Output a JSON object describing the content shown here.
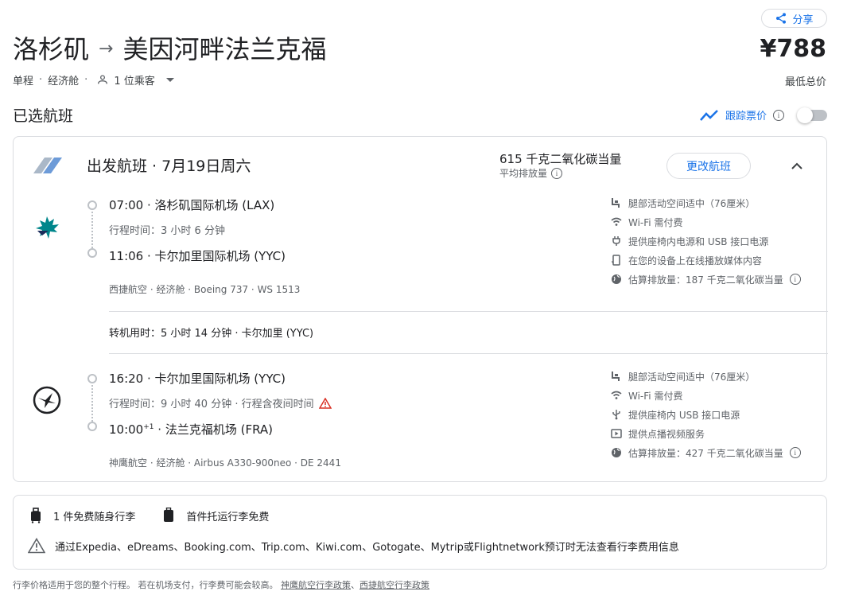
{
  "header": {
    "share_label": "分享",
    "origin": "洛杉矶",
    "destination": "美因河畔法兰克福",
    "trip_type": "单程",
    "cabin": "经济舱",
    "passengers": "1 位乘客",
    "price": "¥788",
    "price_label": "最低总价"
  },
  "selected": {
    "title": "已选航班",
    "track_label": "跟踪票价"
  },
  "flight": {
    "title": "出发航班 · 7月19日周六",
    "co2_main": "615 千克二氧化碳当量",
    "co2_sub": "平均排放量",
    "change_label": "更改航班",
    "layover": "转机用时：5 小时 14 分钟 · 卡尔加里 (YYC)",
    "segments": [
      {
        "dep": "07:00 · 洛杉矶国际机场 (LAX)",
        "duration": "行程时间：3 小时 6 分钟",
        "arr_time": "11:06",
        "arr_sup": "",
        "arr_airport": " · 卡尔加里国际机场 (YYC)",
        "detail": "西捷航空 · 经济舱 · Boeing 737 · WS 1513",
        "amenities": [
          {
            "icon": "legroom-icon",
            "text": "腿部活动空间适中（76厘米）"
          },
          {
            "icon": "wifi-icon",
            "text": "Wi-Fi 需付费"
          },
          {
            "icon": "power-plug-icon",
            "text": "提供座椅内电源和 USB 接口电源"
          },
          {
            "icon": "device-stream-icon",
            "text": "在您的设备上在线播放媒体内容"
          },
          {
            "icon": "globe-icon",
            "text": "估算排放量：187 千克二氧化碳当量"
          }
        ]
      },
      {
        "dep": "16:20 · 卡尔加里国际机场 (YYC)",
        "duration": "行程时间：9 小时 40 分钟 · 行程含夜间时间",
        "arr_time": "10:00",
        "arr_sup": "+1",
        "arr_airport": " · 法兰克福机场 (FRA)",
        "detail": "神鹰航空 · 经济舱 · Airbus A330-900neo · DE 2441",
        "amenities": [
          {
            "icon": "legroom-icon",
            "text": "腿部活动空间适中（76厘米）"
          },
          {
            "icon": "wifi-icon",
            "text": "Wi-Fi 需付费"
          },
          {
            "icon": "usb-icon",
            "text": "提供座椅内 USB 接口电源"
          },
          {
            "icon": "video-icon",
            "text": "提供点播视频服务"
          },
          {
            "icon": "globe-icon",
            "text": "估算排放量：427 千克二氧化碳当量"
          }
        ]
      }
    ]
  },
  "baggage": {
    "carry_on": "1 件免费随身行李",
    "checked": "首件托运行李免费",
    "warning": "通过Expedia、eDreams、Booking.com、Trip.com、Kiwi.com、Gotogate、Mytrip或Flightnetwork预订时无法查看行李费用信息"
  },
  "footer": {
    "text": "行李价格适用于您的整个行程。 若在机场支付，行李费可能会较高。",
    "link1": "神鹰航空行李政策",
    "sep": "、",
    "link2": "西捷航空行李政策"
  },
  "colors": {
    "accent": "#1a73e8",
    "text": "#202124",
    "muted": "#5f6368",
    "border": "#dadce0",
    "westjet_teal": "#00868b",
    "warning_red": "#d93025"
  }
}
